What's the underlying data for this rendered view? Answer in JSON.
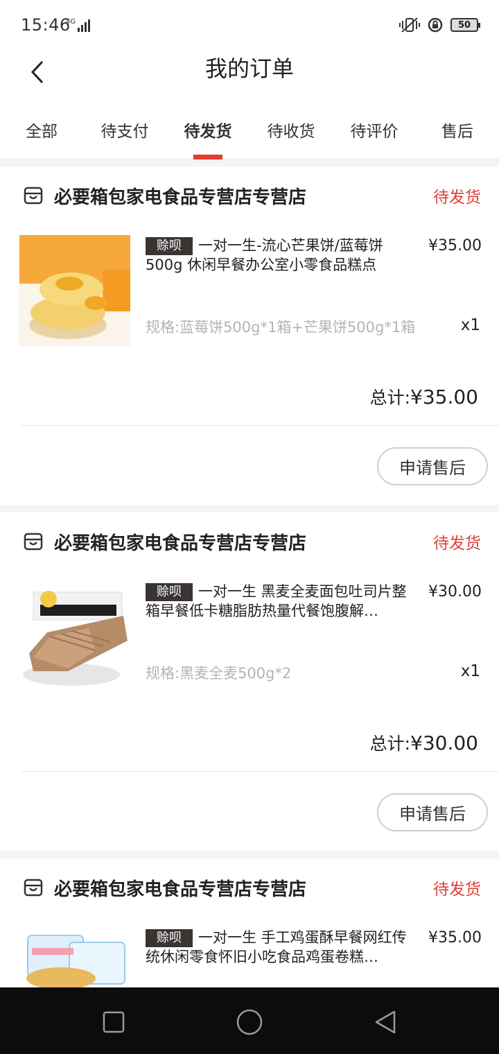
{
  "status_bar": {
    "time": "15:46",
    "network": "4G",
    "battery": "50"
  },
  "header": {
    "title": "我的订单",
    "back_icon": "chevron-left-icon"
  },
  "tabs": [
    {
      "label": "全部",
      "active": false
    },
    {
      "label": "待支付",
      "active": false
    },
    {
      "label": "待发货",
      "active": true
    },
    {
      "label": "待收货",
      "active": false
    },
    {
      "label": "待评价",
      "active": false
    },
    {
      "label": "售后",
      "active": false
    }
  ],
  "colors": {
    "accent": "#e93b2f",
    "status_text": "#e0403a",
    "tag_bg": "#3a3433"
  },
  "orders": [
    {
      "store": "必要箱包家电食品专营店专营店",
      "status": "待发货",
      "tag": "赊呗",
      "product_title": "一对一生-流心芒果饼/蓝莓饼500g 休闲早餐办公室小零食品糕点",
      "price": "¥35.00",
      "spec": "规格:蓝莓饼500g*1箱+芒果饼500g*1箱",
      "qty": "x1",
      "total_label": "总计:",
      "total": "¥35.00",
      "action": "申请售后",
      "image": "mango-cake"
    },
    {
      "store": "必要箱包家电食品专营店专营店",
      "status": "待发货",
      "tag": "赊呗",
      "product_title": "一对一生 黑麦全麦面包吐司片整箱早餐低卡糖脂肪热量代餐饱腹解…",
      "price": "¥30.00",
      "spec": "规格:黑麦全麦500g*2",
      "qty": "x1",
      "total_label": "总计:",
      "total": "¥30.00",
      "action": "申请售后",
      "image": "rye-bread"
    },
    {
      "store": "必要箱包家电食品专营店专营店",
      "status": "待发货",
      "tag": "赊呗",
      "product_title": "一对一生 手工鸡蛋酥早餐网红传统休闲零食怀旧小吃食品鸡蛋卷糕…",
      "price": "¥35.00",
      "image": "egg-roll"
    }
  ],
  "nav": {
    "recent": "square-icon",
    "home": "circle-icon",
    "back": "triangle-back-icon"
  }
}
